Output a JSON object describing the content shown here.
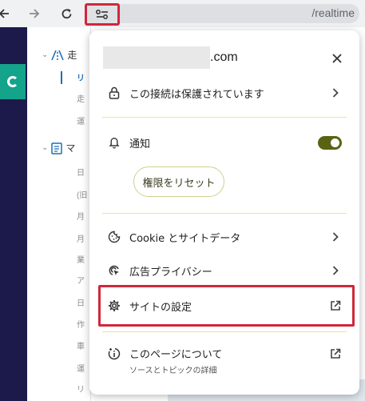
{
  "toolbar": {
    "back_icon": "arrow-left-icon",
    "forward_icon": "arrow-right-icon",
    "reload_icon": "reload-icon",
    "site_info_icon": "tune-icon",
    "url_path": "/realtime"
  },
  "sidebar": {
    "heads": [
      "走",
      "マ"
    ],
    "items": [
      "リ",
      "走",
      "運",
      "日",
      "(旧",
      "月",
      "月",
      "業",
      "ア",
      "日",
      "作",
      "車",
      "運",
      "リ"
    ]
  },
  "popup": {
    "domain": ".com",
    "close_icon": "close-icon",
    "connection": {
      "label": "この接続は保護されています",
      "icon": "lock-icon"
    },
    "notifications": {
      "label": "通知",
      "icon": "bell-icon",
      "enabled": true
    },
    "reset_permissions": {
      "label": "権限をリセット"
    },
    "cookies": {
      "label": "Cookie とサイトデータ",
      "icon": "cookie-icon"
    },
    "ad_privacy": {
      "label": "広告プライバシー",
      "icon": "ad-privacy-icon"
    },
    "site_settings": {
      "label": "サイトの設定",
      "icon": "gear-icon"
    },
    "about_page": {
      "label": "このページについて",
      "sublabel": "ソースとトピックの詳細",
      "icon": "about-icon"
    }
  },
  "colors": {
    "highlight": "#d0273b",
    "toggle_on": "#5a6312",
    "divider": "#eae68f",
    "rail": "#1c1a4b",
    "brand": "#14a38b"
  }
}
